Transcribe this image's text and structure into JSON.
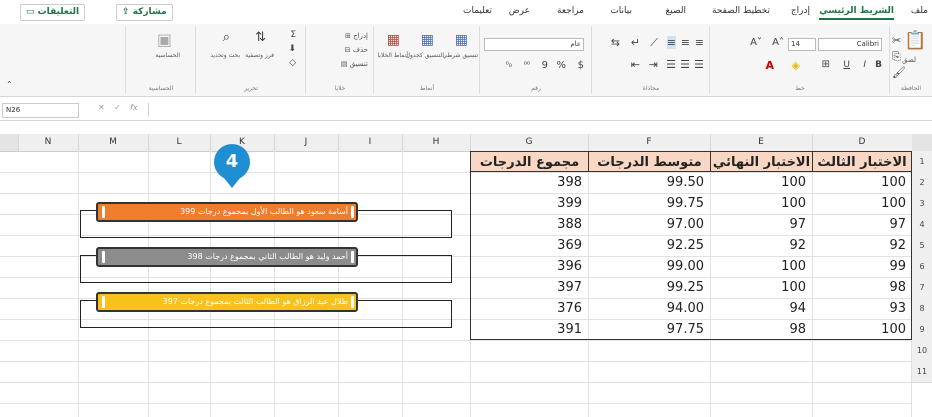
{
  "tabs": [
    "ملف",
    "الشريط الرئيسي",
    "إدراج",
    "تخطيط الصفحة",
    "الصيغ",
    "بيانات",
    "مراجعة",
    "عرض",
    "تعليمات"
  ],
  "share_label": "مشاركة",
  "comments_label": "التعليقات",
  "ribbon": {
    "font_name": "Calibri",
    "font_size": "14",
    "number_format": "عام",
    "group_labels": [
      "الحافظة",
      "خط",
      "محاذاة",
      "رقم",
      "أنماط",
      "خلايا",
      "تحرير",
      "الحساسية"
    ],
    "styles_items": [
      "تنسيق شرطي",
      "التنسيق كجدول",
      "أنماط الخلايا"
    ],
    "cells_items": [
      "إدراج",
      "حذف",
      "تنسيق"
    ],
    "editing_items": [
      "فرز وتصفية",
      "بحث وتحديد"
    ],
    "sensitivity_label": "الحساسية",
    "paste_label": "لصق"
  },
  "formula_bar": {
    "name_box": "N26",
    "fx": "fx"
  },
  "columns": [
    "N",
    "M",
    "L",
    "K",
    "J",
    "I",
    "H",
    "G",
    "F",
    "E",
    "D"
  ],
  "row_numbers": [
    "1",
    "2",
    "3",
    "4",
    "5",
    "6",
    "7",
    "8",
    "9",
    "10",
    "11"
  ],
  "table": {
    "headers": [
      "الاختبار الثالث",
      "الاختبار النهائي",
      "متوسط الدرجات",
      "مجموع الدرجات"
    ],
    "rows": [
      [
        "100",
        "100",
        "99.50",
        "398"
      ],
      [
        "100",
        "100",
        "99.75",
        "399"
      ],
      [
        "97",
        "97",
        "97.00",
        "388"
      ],
      [
        "92",
        "92",
        "92.25",
        "369"
      ],
      [
        "99",
        "100",
        "99.00",
        "396"
      ],
      [
        "98",
        "100",
        "99.25",
        "397"
      ],
      [
        "93",
        "94",
        "94.00",
        "376"
      ],
      [
        "100",
        "98",
        "97.75",
        "391"
      ]
    ]
  },
  "callouts": [
    {
      "text": "أسامة سعود هو الطالب الأول بمجموع درجات 399",
      "color": "#f07d2c"
    },
    {
      "text": "أحمد وليد هو الطالب الثاني بمجموع درجات 398",
      "color": "#8c8c8c"
    },
    {
      "text": "طلال عبد الرزاق هو الطالب الثالث بمجموع درجات 397",
      "color": "#f7c21b"
    }
  ],
  "badge_number": "4",
  "colors": {
    "accent": "#217346",
    "header_fill": "#f8d8c4",
    "badge": "#1f8ed3"
  }
}
